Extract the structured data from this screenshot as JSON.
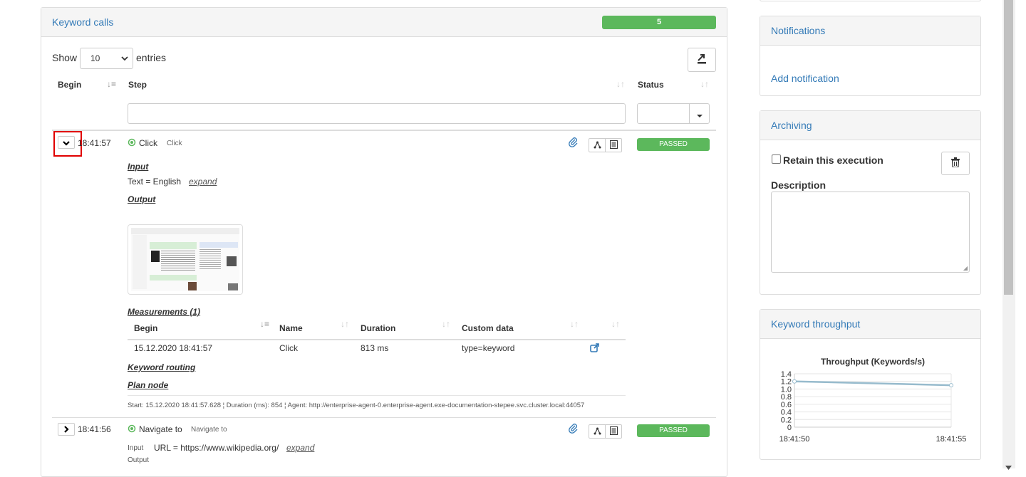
{
  "keyword_calls": {
    "title": "Keyword calls",
    "count": "5",
    "show_label": "Show",
    "entries_value": "10",
    "entries_label": "entries",
    "columns": {
      "begin": "Begin",
      "step": "Step",
      "status": "Status"
    },
    "rows": [
      {
        "time": "18:41:57",
        "step_name": "Click",
        "step_type": "Click",
        "status": "PASSED",
        "input_label": "Input",
        "input_value": "Text = English",
        "expand": "expand",
        "output_label": "Output",
        "measurements_label": "Measurements (1)",
        "measure_columns": {
          "begin": "Begin",
          "name": "Name",
          "duration": "Duration",
          "custom": "Custom data"
        },
        "measure_row": {
          "begin": "15.12.2020 18:41:57",
          "name": "Click",
          "duration": "813 ms",
          "custom": "type=keyword"
        },
        "routing_label": "Keyword routing",
        "plan_label": "Plan node",
        "footer": "Start: 15.12.2020 18:41:57.628 ¦ Duration (ms): 854 ¦ Agent: http://enterprise-agent-0.enterprise-agent.exe-documentation-stepee.svc.cluster.local:44057"
      },
      {
        "time": "18:41:56",
        "step_name": "Navigate to",
        "step_type": "Navigate to",
        "status": "PASSED",
        "input_label": "Input",
        "input_value": "URL = https://www.wikipedia.org/",
        "expand": "expand",
        "output_label": "Output"
      }
    ]
  },
  "notifications": {
    "title": "Notifications",
    "add_label": "Add notification"
  },
  "archiving": {
    "title": "Archiving",
    "retain_label": "Retain this execution",
    "description_label": "Description"
  },
  "throughput": {
    "title": "Keyword throughput",
    "chart_data": {
      "type": "line",
      "title": "Throughput (Keywords/s)",
      "x": [
        "18:41:50",
        "18:41:55"
      ],
      "series": [
        {
          "values": [
            1.2,
            1.1
          ]
        }
      ],
      "ylim": [
        0,
        1.4
      ],
      "yticks": [
        "1.4",
        "1.2",
        "1.0",
        "0.8",
        "0.6",
        "0.4",
        "0.2",
        "0"
      ],
      "grid": true
    }
  },
  "colors": {
    "accent": "#337ab7",
    "success": "#5cb85c",
    "highlight": "#e00000"
  }
}
